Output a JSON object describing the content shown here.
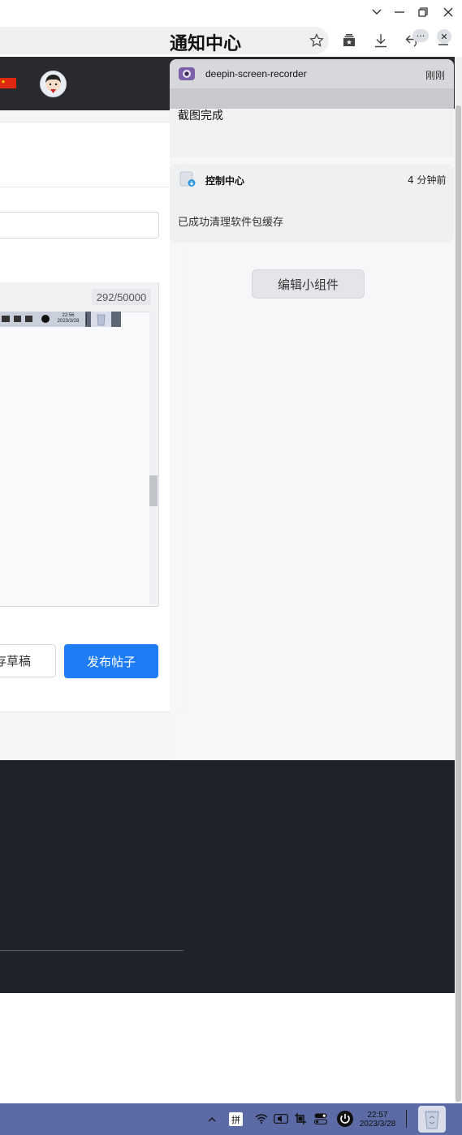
{
  "window": {
    "controls": [
      "chevron-down",
      "minimize",
      "restore",
      "close"
    ]
  },
  "notification_center": {
    "title": "通知中心",
    "more_label": "···",
    "close_label": "✕",
    "notifications": [
      {
        "app": "deepin-screen-recorder",
        "time": "刚刚",
        "body": "截图完成"
      },
      {
        "app": "控制中心",
        "time": "4 分钟前",
        "body": "已成功清理软件包缓存"
      }
    ],
    "edit_widgets_label": "编辑小组件"
  },
  "editor": {
    "counter": "292/50000",
    "thumbnail_clock": {
      "time": "22:56",
      "date": "2023/3/28"
    }
  },
  "actions": {
    "save_draft_label": "存草稿",
    "publish_label": "发布帖子"
  },
  "taskbar": {
    "ime_label": "拼",
    "clock_time": "22:57",
    "clock_date": "2023/3/28"
  },
  "colors": {
    "publish_button": "#1e7cf7",
    "footer": "#1f222a",
    "site_header": "#2a2a2e",
    "taskbar": "#5c6aa6"
  }
}
